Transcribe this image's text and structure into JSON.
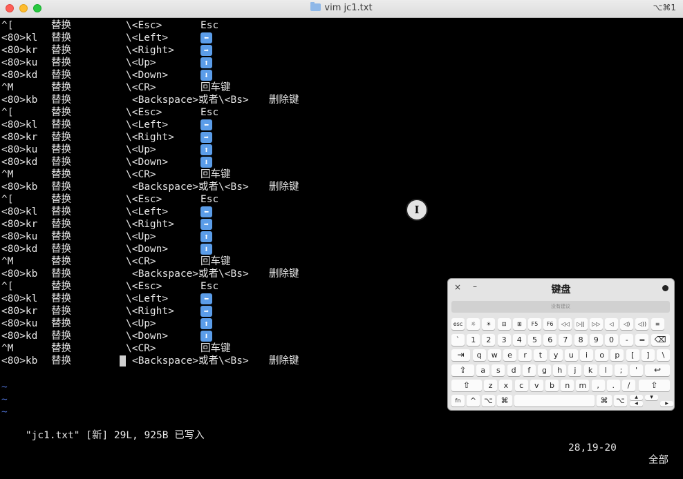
{
  "window": {
    "title": "vim jc1.txt",
    "shortcut": "⌥⌘1"
  },
  "lines": [
    [
      "^[",
      "替换",
      "\\<Esc>",
      "Esc"
    ],
    [
      "<80>kl",
      "替换",
      "\\<Left>",
      "⬅"
    ],
    [
      "<80>kr",
      "替换",
      "\\<Right>",
      "➡"
    ],
    [
      "<80>ku",
      "替换",
      "\\<Up>",
      "⬆"
    ],
    [
      "<80>kd",
      "替换",
      "\\<Down>",
      "⬇"
    ],
    [
      "^M",
      "替换",
      "\\<CR>",
      "回车键"
    ],
    [
      "<80>kb",
      "替换",
      "<Backspace>或者\\<Bs>",
      "删除键"
    ]
  ],
  "tilde": "~",
  "status": {
    "message": "\"jc1.txt\" [新] 29L, 925B 已写入",
    "position": "28,19-20",
    "mode": "全部"
  },
  "keyboard": {
    "title": "键盘",
    "close": "×",
    "minimize": "–",
    "suggestion": "没有建议",
    "fn_row": [
      "esc",
      "☼",
      "☀",
      "⊟",
      "⊞",
      "F5",
      "F6",
      "◁◁",
      "▷||",
      "▷▷",
      "◁",
      "◁)",
      "◁))",
      "≡"
    ],
    "num_row": [
      "`",
      "1",
      "2",
      "3",
      "4",
      "5",
      "6",
      "7",
      "8",
      "9",
      "0",
      "-",
      "=",
      "⌫"
    ],
    "q_row": [
      "⇥",
      "q",
      "w",
      "e",
      "r",
      "t",
      "y",
      "u",
      "i",
      "o",
      "p",
      "[",
      "]",
      "\\"
    ],
    "a_row": [
      "⇪",
      "a",
      "s",
      "d",
      "f",
      "g",
      "h",
      "j",
      "k",
      "l",
      ";",
      "'",
      "↩"
    ],
    "z_row": [
      "⇧",
      "z",
      "x",
      "c",
      "v",
      "b",
      "n",
      "m",
      ",",
      ".",
      "/",
      "⇧"
    ],
    "bottom_row": [
      "fn",
      "^",
      "⌥",
      "⌘",
      "",
      "⌘",
      "⌥",
      "▲",
      "◀",
      "▼",
      "▶"
    ]
  }
}
